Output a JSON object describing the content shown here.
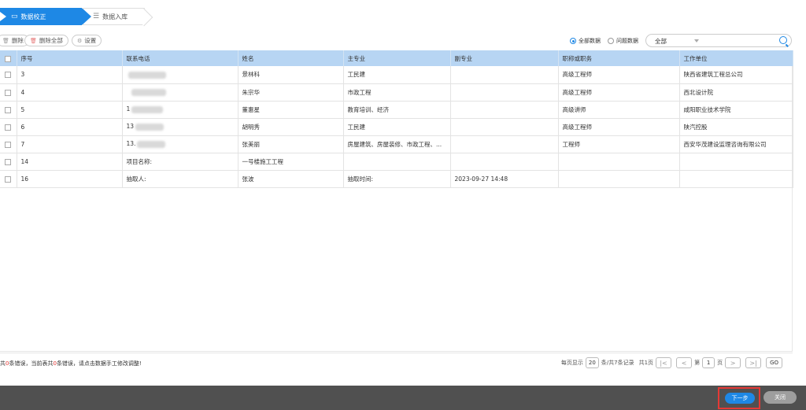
{
  "steps": [
    {
      "label": "数据校正",
      "icon": "monitor-icon",
      "active": true
    },
    {
      "label": "数据入库",
      "icon": "database-icon",
      "active": false
    }
  ],
  "toolbar": {
    "delete_label": "删除",
    "delete_all_label": "删除全部",
    "settings_label": "设置",
    "filter_all_label": "全部数据",
    "filter_problem_label": "问题数据",
    "select_value": "全部"
  },
  "table": {
    "headers": [
      "序号",
      "联系电话",
      "姓名",
      "主专业",
      "副专业",
      "职称或职务",
      "工作单位"
    ],
    "rows": [
      {
        "no": "3",
        "phone": "",
        "name": "景林科",
        "major": "工民建",
        "minor": "",
        "title": "高级工程师",
        "org": "陕西省建筑工程总公司"
      },
      {
        "no": "4",
        "phone": "",
        "name": "朱宗华",
        "major": "市政工程",
        "minor": "",
        "title": "高级工程师",
        "org": "西北设计院"
      },
      {
        "no": "5",
        "phone": "1",
        "name": "董惠星",
        "major": "教育培训、经济",
        "minor": "",
        "title": "高级讲师",
        "org": "咸阳职业技术学院"
      },
      {
        "no": "6",
        "phone": "13",
        "name": "胡明秀",
        "major": "工民建",
        "minor": "",
        "title": "高级工程师",
        "org": "陕汽控股"
      },
      {
        "no": "7",
        "phone": "13.",
        "name": "张美丽",
        "major": "房屋建筑、房屋装修、市政工程、...",
        "minor": "",
        "title": "工程师",
        "org": "西安华茂建设监理咨询有限公司"
      },
      {
        "no": "14",
        "phone": "项目名称:",
        "name": "一号楼施工工程",
        "major": "",
        "minor": "",
        "title": "",
        "org": ""
      },
      {
        "no": "16",
        "phone": "抽取人:",
        "name": "张波",
        "major": "抽取时间:",
        "minor": "2023-09-27 14:48",
        "title": "",
        "org": ""
      }
    ]
  },
  "footer": {
    "msg_prefix": "共",
    "err_count": "0",
    "msg_mid": "条错误，当前表共",
    "err_count2": "0",
    "msg_suffix": "条错误，请点击数据手工修改调整!",
    "per_page_label": "每页显示",
    "per_page": "20",
    "total_label": "条/共7条记录",
    "pages_label": "共1页",
    "page_prefix": "第",
    "page_value": "1",
    "page_suffix": "页",
    "go_label": "GO"
  },
  "bottom": {
    "next_label": "下一步",
    "close_label": "关闭"
  },
  "colors": {
    "accent": "#1e88e5",
    "header_bg": "#b7d5f3",
    "highlight": "#e53935"
  }
}
